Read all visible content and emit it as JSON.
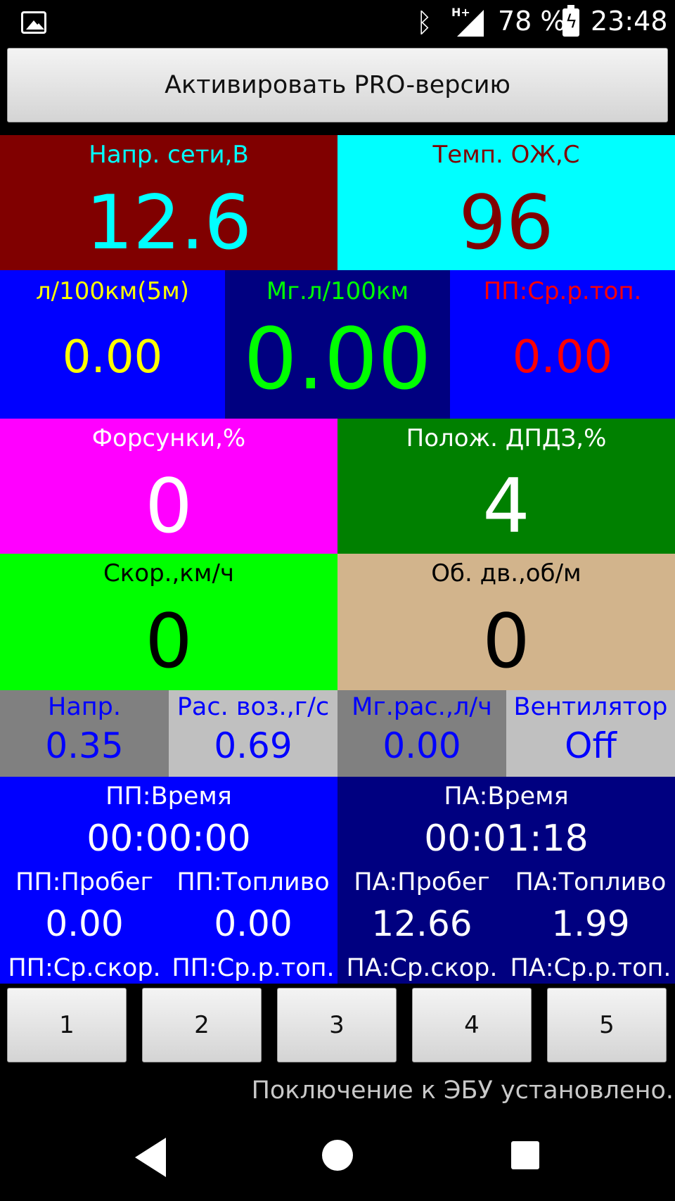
{
  "status_bar": {
    "network": "H+",
    "battery_pct": "78 %",
    "time": "23:48",
    "icons": [
      "gallery-icon",
      "bluetooth-icon",
      "signal-icon",
      "battery-charging-icon"
    ]
  },
  "pro_button": "Активировать PRO-версию",
  "gauges": {
    "voltage": {
      "label": "Напр. сети,В",
      "value": "12.6"
    },
    "coolant": {
      "label": "Темп. ОЖ,С",
      "value": "96"
    },
    "fuel_5m": {
      "label": "л/100км(5м)",
      "value": "0.00"
    },
    "fuel_instant": {
      "label": "Мг.л/100км",
      "value": "0.00"
    },
    "trip_avg_fuel": {
      "label": "ПП:Ср.р.топ.",
      "value": "0.00"
    },
    "injectors": {
      "label": "Форсунки,%",
      "value": "0"
    },
    "throttle": {
      "label": "Полож. ДПДЗ,%",
      "value": "4"
    },
    "speed": {
      "label": "Скор.,км/ч",
      "value": "0"
    },
    "rpm": {
      "label": "Об. дв.,об/м",
      "value": "0"
    },
    "sensor_voltage": {
      "label": "Напр.",
      "value": "0.35"
    },
    "air_flow": {
      "label": "Рас. воз.,г/с",
      "value": "0.69"
    },
    "fuel_rate": {
      "label": "Мг.рас.,л/ч",
      "value": "0.00"
    },
    "fan": {
      "label": "Вентилятор",
      "value": "Off"
    }
  },
  "trip_pp": {
    "time_label": "ПП:Время",
    "time_value": "00:00:00",
    "distance_label": "ПП:Пробег",
    "distance_value": "0.00",
    "fuel_label": "ПП:Топливо",
    "fuel_value": "0.00",
    "avg_speed_label": "ПП:Ср.скор.",
    "avg_fuel_label": "ПП:Ср.р.топ."
  },
  "trip_pa": {
    "time_label": "ПА:Время",
    "time_value": "00:01:18",
    "distance_label": "ПА:Пробег",
    "distance_value": "12.66",
    "fuel_label": "ПА:Топливо",
    "fuel_value": "1.99",
    "avg_speed_label": "ПА:Ср.скор.",
    "avg_fuel_label": "ПА:Ср.р.топ."
  },
  "page_buttons": [
    "1",
    "2",
    "3",
    "4",
    "5"
  ],
  "connection_status": "Поключение к ЭБУ установлено.",
  "colors": {
    "voltage_bg": "#800000",
    "voltage_fg": "#00ffff",
    "coolant_bg": "#00ffff",
    "coolant_fg": "#800000",
    "blue": "#0000ff",
    "navy": "#000080",
    "yellow": "#ffff00",
    "lime": "#00ff00",
    "red": "#ff0000",
    "magenta": "#ff00ff",
    "green": "#008000",
    "tan": "#d2b48c",
    "gray": "#808080",
    "lightgray": "#c0c0c0"
  }
}
